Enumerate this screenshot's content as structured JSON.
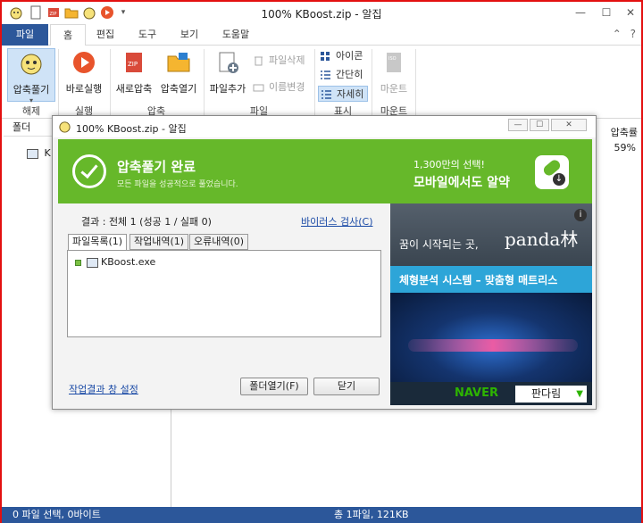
{
  "window": {
    "title": "100% KBoost.zip - 알집",
    "minimize": "—",
    "restore": "☐",
    "close": "✕"
  },
  "ribbon_tabs": [
    "파일",
    "홈",
    "편집",
    "도구",
    "보기",
    "도움말"
  ],
  "ribbon": {
    "extract": "압축풀기",
    "run": "바로실행",
    "new_archive": "새로압축",
    "open_archive": "압축열기",
    "add_file": "파일추가",
    "delete_file": "파일삭제",
    "rename": "이름변경",
    "view_icon": "아이콘",
    "view_simple": "간단히",
    "view_detail": "자세히",
    "mount": "마운트",
    "groups": {
      "release": "해제",
      "run": "실행",
      "compress": "압축",
      "file": "파일",
      "display": "표시",
      "mount": "마운트"
    }
  },
  "main": {
    "folder_header": "폴더",
    "tree_item": "K",
    "compress_col": "압축률",
    "compress_value": "59%"
  },
  "status": {
    "left": "0 파일 선택, 0바이트",
    "right": "총 1파일, 121KB"
  },
  "dialog": {
    "title": "100% KBoost.zip - 알집",
    "banner_title": "압축풀기 완료",
    "banner_sub": "모든 파일을 성공적으로 풀었습니다.",
    "result": "결과 : 전체 1 (성공 1 / 실패 0)",
    "virus_link": "바이러스 검사(C)",
    "tabs": [
      "파일목록(1)",
      "작업내역(1)",
      "오류내역(0)"
    ],
    "file_name": "KBoost.exe",
    "settings_link": "작업결과 창 설정",
    "open_folder": "폴더열기(F)",
    "close": "닫기"
  },
  "ads": {
    "top_line1": "1,300만의 선택!",
    "top_line2": "모바일에서도 알약",
    "dream": "꿈이 시작되는 곳,",
    "panda": "panda林",
    "info": "i",
    "band": "체형분석 시스템 – 맞춤형 매트리스",
    "naver": "NAVER",
    "brand": "판다림",
    "brand_arrow": "▼"
  },
  "colors": {
    "accent_blue": "#2c579a",
    "green": "#66b82a",
    "frame_red": "#e31010"
  }
}
